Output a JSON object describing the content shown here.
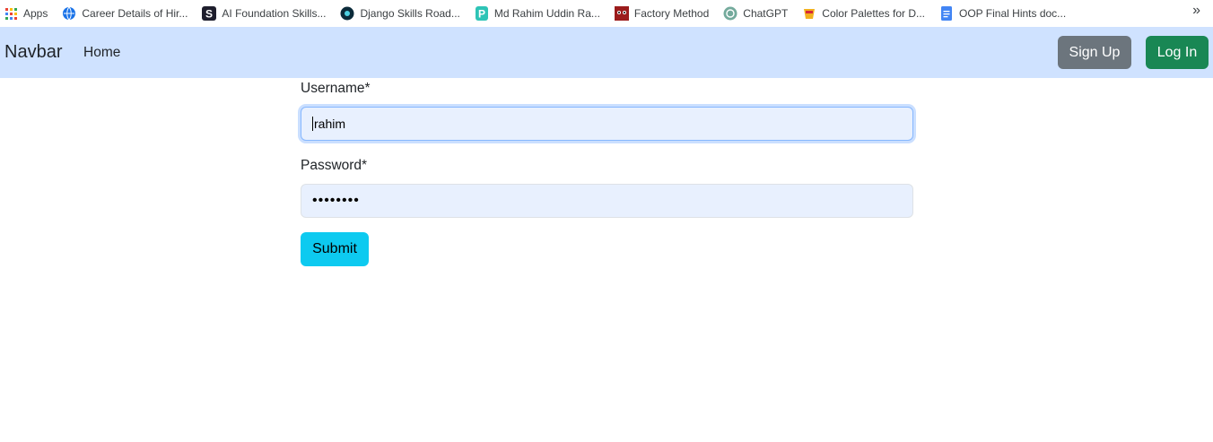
{
  "bookmarks": {
    "apps_label": "Apps",
    "items": [
      {
        "label": "Career Details of Hir...",
        "icon": "globe-icon",
        "color": "#1a73e8"
      },
      {
        "label": "AI Foundation Skills...",
        "icon": "s-logo-icon",
        "color": "#1e1e2d"
      },
      {
        "label": "Django Skills Road...",
        "icon": "circle-logo-icon",
        "color": "#0b2b3a"
      },
      {
        "label": "Md Rahim Uddin Ra...",
        "icon": "p-logo-icon",
        "color": "#2ec4b6"
      },
      {
        "label": "Factory Method",
        "icon": "raccoon-logo-icon",
        "color": "#9b1c1c"
      },
      {
        "label": "ChatGPT",
        "icon": "chatgpt-icon",
        "color": "#74aa9c"
      },
      {
        "label": "Color Palettes for D...",
        "icon": "palette-icon",
        "color": "#f2b01e"
      },
      {
        "label": "OOP Final Hints doc...",
        "icon": "doc-icon",
        "color": "#4285f4"
      }
    ],
    "more_label": "»"
  },
  "navbar": {
    "brand": "Navbar",
    "home": "Home",
    "signup": "Sign Up",
    "login": "Log In"
  },
  "form": {
    "username_label": "Username*",
    "username_value": "rahim",
    "password_label": "Password*",
    "password_value": "••••••••",
    "submit": "Submit"
  },
  "colors": {
    "navbar_bg": "#cfe2ff",
    "signup_bg": "#6c757d",
    "login_bg": "#198754",
    "submit_bg": "#0dcaf0",
    "input_bg": "#e8f0fe"
  }
}
